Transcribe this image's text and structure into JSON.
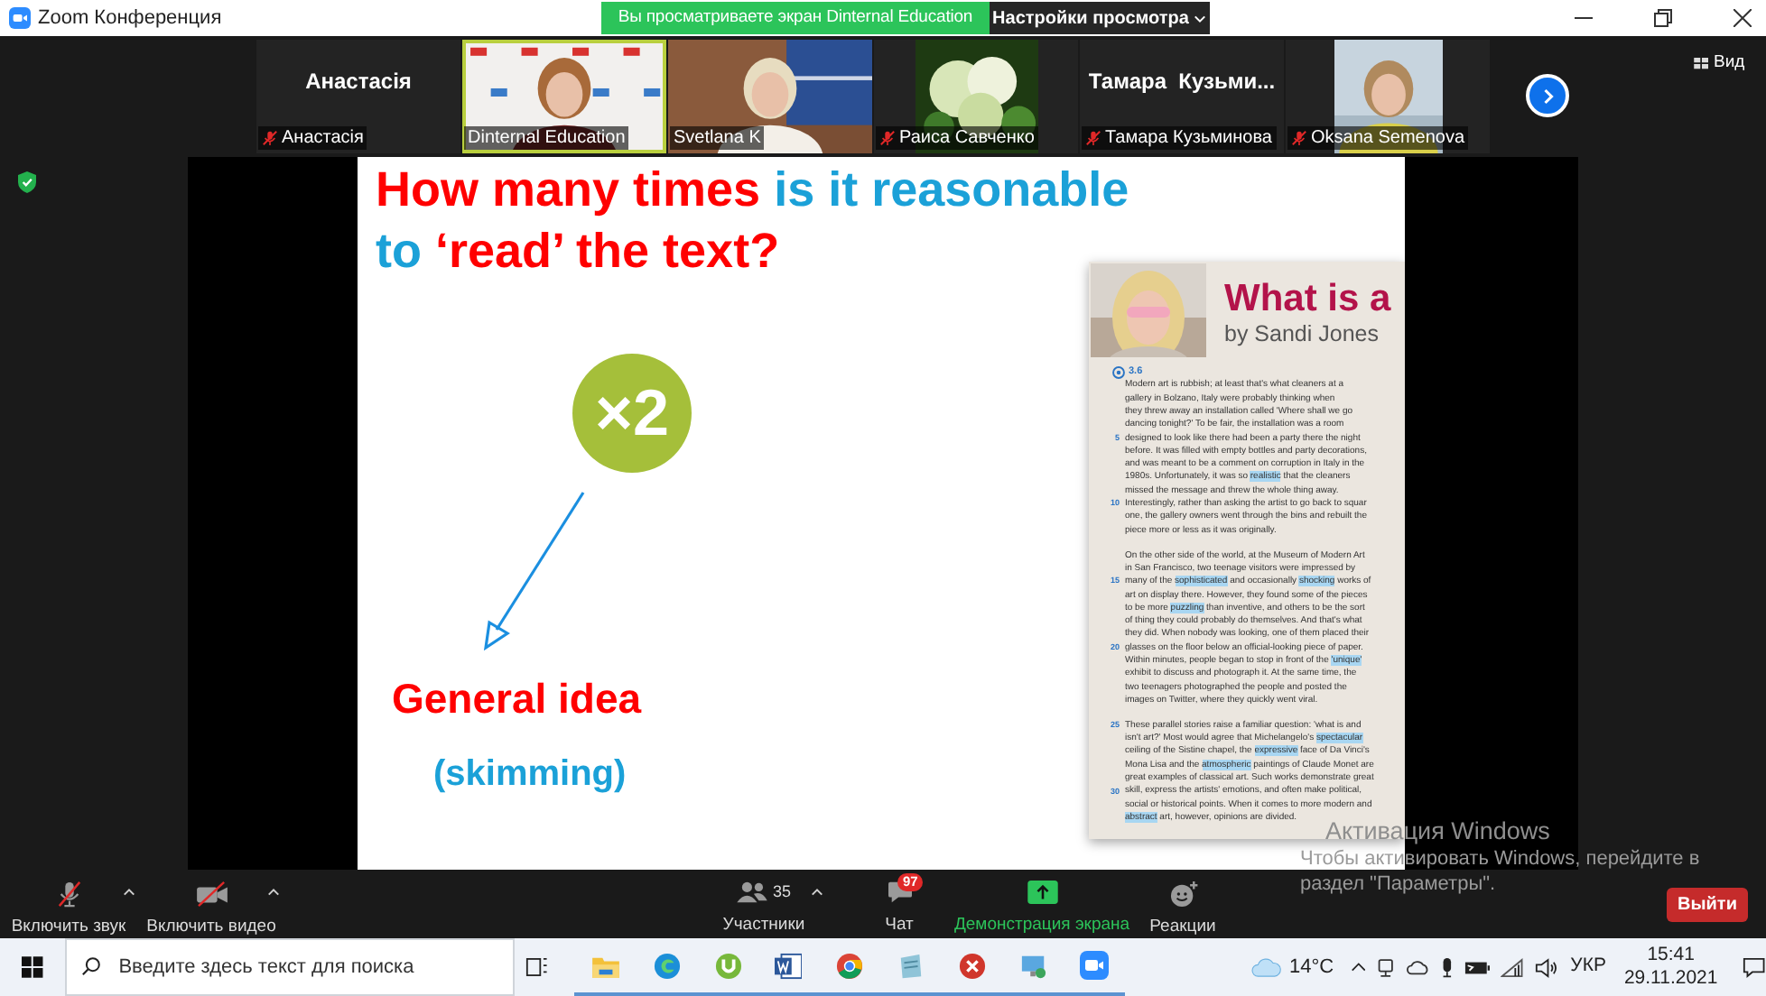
{
  "window": {
    "title": "Zoom Конференция"
  },
  "share_banner": {
    "text": "Вы просматриваете экран Dinternal Education",
    "view_settings": "Настройки просмотра"
  },
  "participants": [
    {
      "kind": "name",
      "display": "Анастасія",
      "name": "Анастасія",
      "muted": true,
      "speaking": false
    },
    {
      "kind": "video",
      "name": "Dinternal Education",
      "muted": false,
      "speaking": true
    },
    {
      "kind": "video",
      "name": "Svetlana K",
      "muted": false,
      "speaking": false
    },
    {
      "kind": "video",
      "name": "Раиса Савченко",
      "muted": true,
      "speaking": false
    },
    {
      "kind": "name",
      "display": "Тамара  Кузьми...",
      "name": "Тамара Кузьминова",
      "muted": true,
      "speaking": false
    },
    {
      "kind": "video",
      "name": "Oksana Semenova",
      "muted": true,
      "speaking": false
    }
  ],
  "view_button": "Вид",
  "slide": {
    "question_lines": [
      [
        {
          "text": "How many times",
          "color": "#ff0000"
        },
        {
          "text": "is it reasonable",
          "color": "#1ba1d8"
        }
      ],
      [
        {
          "text": "to",
          "color": "#1ba1d8"
        },
        {
          "text": "‘read’ the text?",
          "color": "#ff0000"
        }
      ]
    ],
    "badge": "×2",
    "label": "General idea",
    "sublabel": "(skimming)",
    "article": {
      "title": "What is a",
      "byline": "by Sandi Jones",
      "audio": "3.6",
      "paragraphs": [
        [
          {
            "text": "Modern art is rubbish; at least that's what cleaners at a"
          },
          {
            "text": "gallery in Bolzano, Italy were probably thinking when"
          },
          {
            "text": "they threw away an installation called 'Where shall we go"
          },
          {
            "text": "dancing tonight?' To be fair, the installation was a room"
          },
          {
            "number": "5",
            "text": "designed to look like there had been a party there the night"
          },
          {
            "text": "before. It was filled with empty bottles and party decorations,"
          },
          {
            "text": "and was meant to be a comment on corruption in Italy in the"
          },
          {
            "segments": [
              {
                "text": "1980s. Unfortunately, it was so ",
                "highlighted": false
              },
              {
                "text": "realistic",
                "highlighted": true
              },
              {
                "text": " that the cleaners",
                "highlighted": false
              }
            ]
          },
          {
            "text": "missed the message and threw the whole thing away."
          },
          {
            "number": "10",
            "text": "Interestingly, rather than asking the artist to go back to squar"
          },
          {
            "text": "one, the gallery owners went through the bins and rebuilt the"
          },
          {
            "text": "piece more or less as it was originally."
          }
        ],
        [
          {
            "text": "On the other side of the world, at the Museum of Modern Art"
          },
          {
            "text": "in San Francisco, two teenage visitors were impressed by"
          },
          {
            "number": "15",
            "segments": [
              {
                "text": "many of the ",
                "highlighted": false
              },
              {
                "text": "sophisticated",
                "highlighted": true
              },
              {
                "text": " and occasionally ",
                "highlighted": false
              },
              {
                "text": "shocking",
                "highlighted": true
              },
              {
                "text": " works of",
                "highlighted": false
              }
            ]
          },
          {
            "text": "art on display there. However, they found some of the pieces"
          },
          {
            "segments": [
              {
                "text": "to be more ",
                "highlighted": false
              },
              {
                "text": "puzzling",
                "highlighted": true
              },
              {
                "text": " than inventive, and others to be the sort",
                "highlighted": false
              }
            ]
          },
          {
            "text": "of thing they could probably do themselves. And that's what"
          },
          {
            "text": "they did. When nobody was looking, one of them placed their"
          },
          {
            "number": "20",
            "text": "glasses on the floor below an official-looking piece of paper."
          },
          {
            "segments": [
              {
                "text": "Within minutes, people began to stop in front of the ",
                "highlighted": false
              },
              {
                "text": "'unique'",
                "highlighted": true
              }
            ]
          },
          {
            "text": "exhibit to discuss and photograph it. At the same time, the"
          },
          {
            "text": "two teenagers photographed the people and posted the"
          },
          {
            "text": "images on Twitter, where they quickly went viral."
          }
        ],
        [
          {
            "number": "25",
            "text": "These parallel stories raise a familiar question: 'what is and"
          },
          {
            "segments": [
              {
                "text": "isn't art?' Most would agree that Michelangelo's ",
                "highlighted": false
              },
              {
                "text": "spectacular",
                "highlighted": true
              }
            ]
          },
          {
            "segments": [
              {
                "text": "ceiling of the Sistine chapel, the ",
                "highlighted": false
              },
              {
                "text": "expressive",
                "highlighted": true
              },
              {
                "text": " face of Da Vinci's",
                "highlighted": false
              }
            ]
          },
          {
            "segments": [
              {
                "text": "Mona Lisa and the ",
                "highlighted": false
              },
              {
                "text": "atmospheric",
                "highlighted": true
              },
              {
                "text": " paintings of Claude Monet are",
                "highlighted": false
              }
            ]
          },
          {
            "text": "great examples of classical art. Such works demonstrate great"
          },
          {
            "number": "30",
            "text": "skill, express the artists' emotions, and often make political,"
          },
          {
            "text": "social or historical points. When it comes to more modern and"
          },
          {
            "segments": [
              {
                "text": "abstract",
                "highlighted": true
              },
              {
                "text": " art, however, opinions are divided.",
                "highlighted": false
              }
            ]
          }
        ]
      ]
    }
  },
  "toolbar": [
    {
      "kind": "mic_off",
      "label": "Включить звук",
      "caret": true,
      "highlighted": false
    },
    {
      "kind": "video_off",
      "label": "Включить видео",
      "caret": true,
      "highlighted": false
    },
    {
      "kind": "participants",
      "label": "Участники",
      "count": "35",
      "caret": true,
      "highlighted": false
    },
    {
      "kind": "chat",
      "label": "Чат",
      "badge": "97",
      "caret": false,
      "highlighted": false
    },
    {
      "kind": "share",
      "label": "Демонстрация экрана",
      "caret": false,
      "highlighted": true
    },
    {
      "kind": "reactions",
      "label": "Реакции",
      "caret": false,
      "highlighted": false
    }
  ],
  "leave_button": "Выйти",
  "activation": {
    "title": "Активация Windows",
    "lines": [
      "Чтобы активировать Windows, перейдите в",
      "раздел \"Параметры\"."
    ]
  },
  "taskbar": {
    "search_placeholder": "Введите здесь текст для поиска",
    "apps": [
      {
        "kind": "explorer"
      },
      {
        "kind": "edge"
      },
      {
        "kind": "torrent"
      },
      {
        "kind": "word"
      },
      {
        "kind": "chrome"
      },
      {
        "kind": "notes"
      },
      {
        "kind": "remote"
      },
      {
        "kind": "monitor"
      },
      {
        "kind": "zoom"
      }
    ],
    "temperature": "14°C",
    "language": "УКР",
    "time": "15:41",
    "date": "29.11.2021"
  }
}
